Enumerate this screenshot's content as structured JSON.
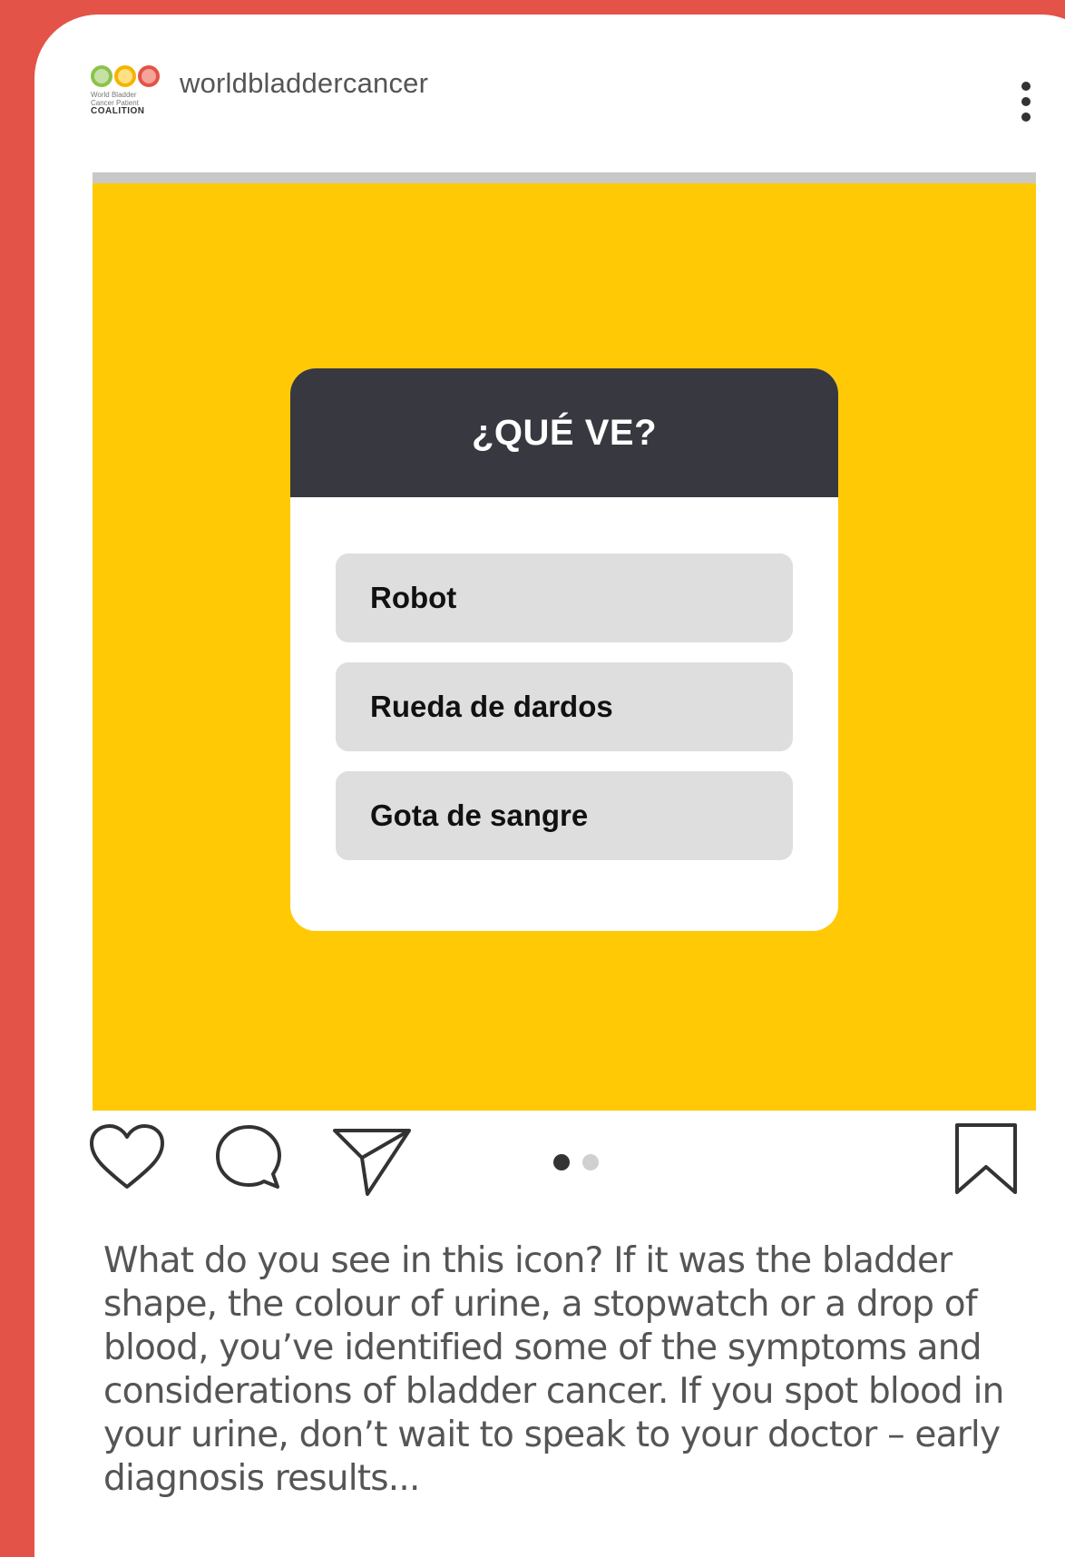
{
  "post": {
    "username": "worldbladdercancer",
    "logo_text": [
      "World Bladder",
      "Cancer Patient",
      "COALITION"
    ]
  },
  "quiz": {
    "title": "¿QUÉ VE?",
    "options": [
      "Robot",
      "Rueda de dardos",
      "Gota de sangre"
    ]
  },
  "carousel": {
    "current": 1,
    "total": 2
  },
  "caption": "What do you see in this icon? If it was the bladder shape, the colour of urine, a stopwatch or a drop of blood, you’ve identified some of the symptoms and considerations of bladder cancer. If you spot blood in your urine, don’t wait to speak to your doctor – early diagnosis results...",
  "icons": [
    "heart-icon",
    "comment-icon",
    "share-icon",
    "bookmark-icon",
    "more-icon"
  ],
  "colors": {
    "background": "#e35347",
    "image_bg": "#ffca05",
    "quiz_header": "#383841"
  }
}
